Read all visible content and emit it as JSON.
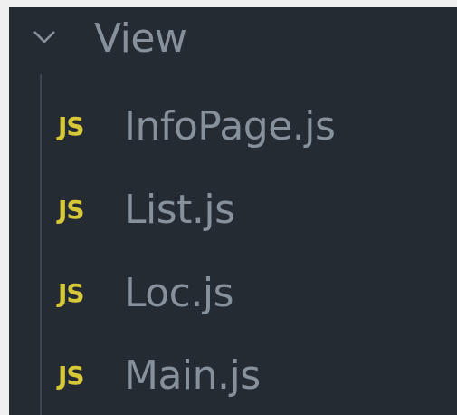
{
  "explorer": {
    "folder": {
      "label": "View",
      "expanded": true,
      "icon": "chevron-down-icon"
    },
    "files": [
      {
        "icon_text": "JS",
        "icon": "javascript-file-icon",
        "label": "InfoPage.js"
      },
      {
        "icon_text": "JS",
        "icon": "javascript-file-icon",
        "label": "List.js"
      },
      {
        "icon_text": "JS",
        "icon": "javascript-file-icon",
        "label": "Loc.js"
      },
      {
        "icon_text": "JS",
        "icon": "javascript-file-icon",
        "label": "Main.js"
      }
    ]
  },
  "colors": {
    "background": "#252b33",
    "text": "#87919c",
    "js_icon": "#d7c838",
    "tree_guide": "#3c434c"
  }
}
